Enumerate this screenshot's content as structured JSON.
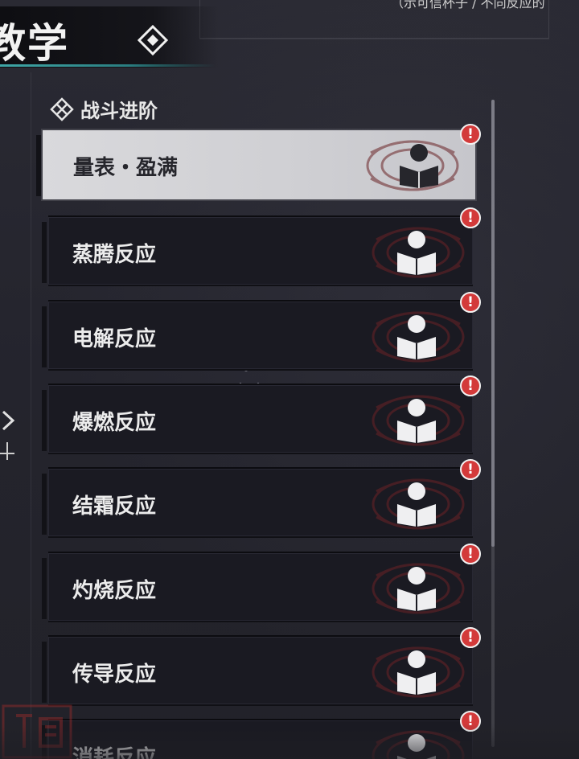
{
  "header": {
    "title": "教学",
    "top_right_text": "（示可信杯子 / 不同反应的"
  },
  "section": {
    "title": "战斗进阶"
  },
  "items": [
    {
      "label": "量表・盈满",
      "selected": true,
      "alert": "!"
    },
    {
      "label": "蒸腾反应",
      "selected": false,
      "alert": "!"
    },
    {
      "label": "电解反应",
      "selected": false,
      "alert": "!"
    },
    {
      "label": "爆燃反应",
      "selected": false,
      "alert": "!"
    },
    {
      "label": "结霜反应",
      "selected": false,
      "alert": "!"
    },
    {
      "label": "灼烧反应",
      "selected": false,
      "alert": "!"
    },
    {
      "label": "传导反应",
      "selected": false,
      "alert": "!"
    },
    {
      "label": "消耗反应",
      "selected": false,
      "alert": "!"
    }
  ],
  "icons": {
    "header": "diamond-icon",
    "section": "crossed-diamond-icon",
    "item": "tutorial-book-person-icon",
    "badge": "alert-icon",
    "left_nav": "chevron-right-icon"
  },
  "colors": {
    "background": "#22222b",
    "accent_teal": "#3fa6a6",
    "alert_red": "#d33a3a",
    "selected_item": "#d9d9dc",
    "item_bg": "#1a1a22",
    "emblem_red": "#6a2326"
  }
}
